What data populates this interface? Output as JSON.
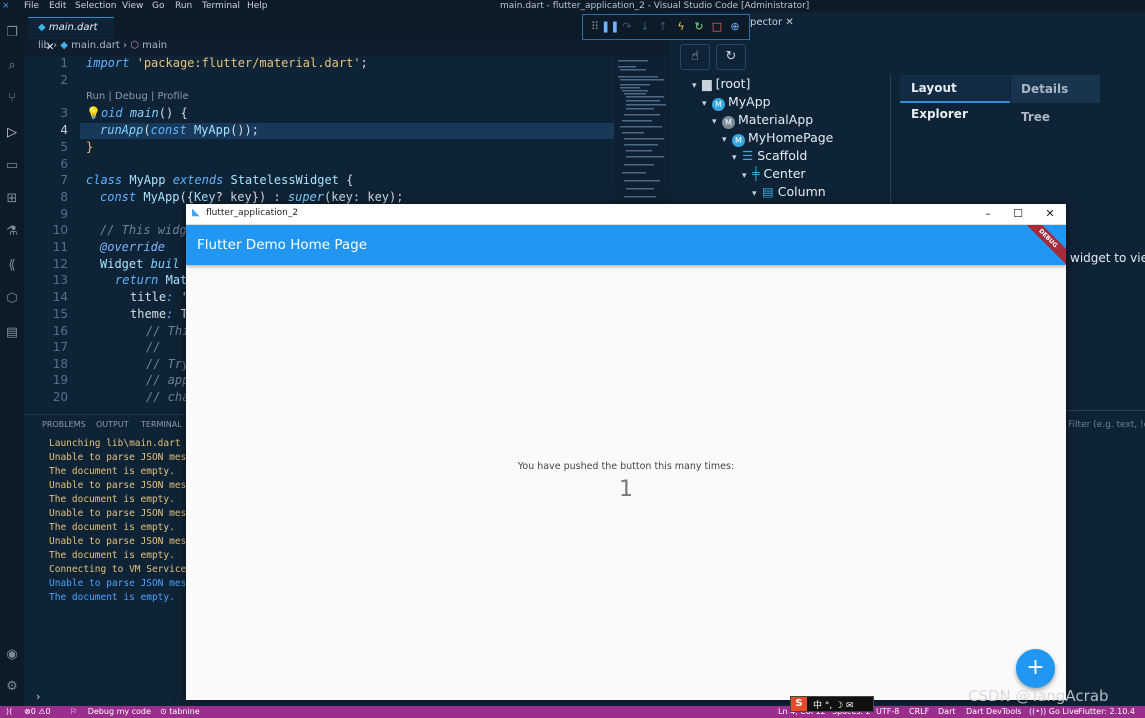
{
  "menu": {
    "items": [
      "File",
      "Edit",
      "Selection",
      "View",
      "Go",
      "Run",
      "Terminal",
      "Help"
    ]
  },
  "window_title": "main.dart - flutter_application_2 - Visual Studio Code [Administrator]",
  "editor": {
    "tab_label": "main.dart",
    "breadcrumb": {
      "folder": "lib",
      "file": "main.dart",
      "symbol": "main"
    },
    "codelens": "Run | Debug | Profile",
    "line_numbers": [
      "1",
      "2",
      "3",
      "4",
      "5",
      "6",
      "7",
      "8",
      "9",
      "10",
      "11",
      "12",
      "13",
      "14",
      "15",
      "16",
      "17",
      "18",
      "19",
      "20"
    ]
  },
  "panel": {
    "tabs": [
      "PROBLEMS",
      "OUTPUT",
      "TERMINAL"
    ],
    "lines": [
      "Launching lib\\main.dart or",
      "Unable to parse JSON messa",
      "The document is empty.",
      "Unable to parse JSON messa",
      "The document is empty.",
      "Unable to parse JSON messa",
      "The document is empty.",
      "Unable to parse JSON messa",
      "The document is empty.",
      "Connecting to VM Service a",
      "Unable to parse JSON messa",
      "The document is empty."
    ]
  },
  "devtools": {
    "inspector_tab": "pector",
    "tree": [
      {
        "label": "[root]",
        "icon": "folder-icon"
      },
      {
        "label": "MyApp",
        "icon": "M"
      },
      {
        "label": "MaterialApp",
        "icon": "M"
      },
      {
        "label": "MyHomePage",
        "icon": "M"
      },
      {
        "label": "Scaffold",
        "icon": "scaffold-icon"
      },
      {
        "label": "Center",
        "icon": "center-icon"
      },
      {
        "label": "Column",
        "icon": "column-icon"
      }
    ],
    "layout_explorer_tab": "Layout Explorer",
    "details_tree_tab": "Details Tree",
    "hint": "widget to view",
    "filter_placeholder": "Filter (e.g. text, !exclu"
  },
  "flutter_window": {
    "title": "flutter_application_2",
    "appbar_title": "Flutter Demo Home Page",
    "debug_banner": "DEBUG",
    "counter_label": "You have pushed the button this many times:",
    "counter_value": "1",
    "fab_label": "+"
  },
  "statusbar": {
    "errors": "0",
    "warnings": "0",
    "debug_label": "Debug my code",
    "tabnine": "tabnine",
    "position": "Ln 4, Col 12",
    "spaces": "Spaces: 2",
    "encoding": "UTF-8",
    "eol": "CRLF",
    "language": "Dart",
    "devtools": "Dart DevTools",
    "golive": "Go Live",
    "flutter_version": "Flutter: 2.10.4"
  },
  "ime": {
    "logo": "S",
    "chars": "中 °, ☽ ✉"
  },
  "watermark": "CSDN @TangAcrab",
  "colors": {
    "accent": "#2196f3",
    "statusbar": "#9b2d8c",
    "editor_bg": "#0f2336"
  }
}
